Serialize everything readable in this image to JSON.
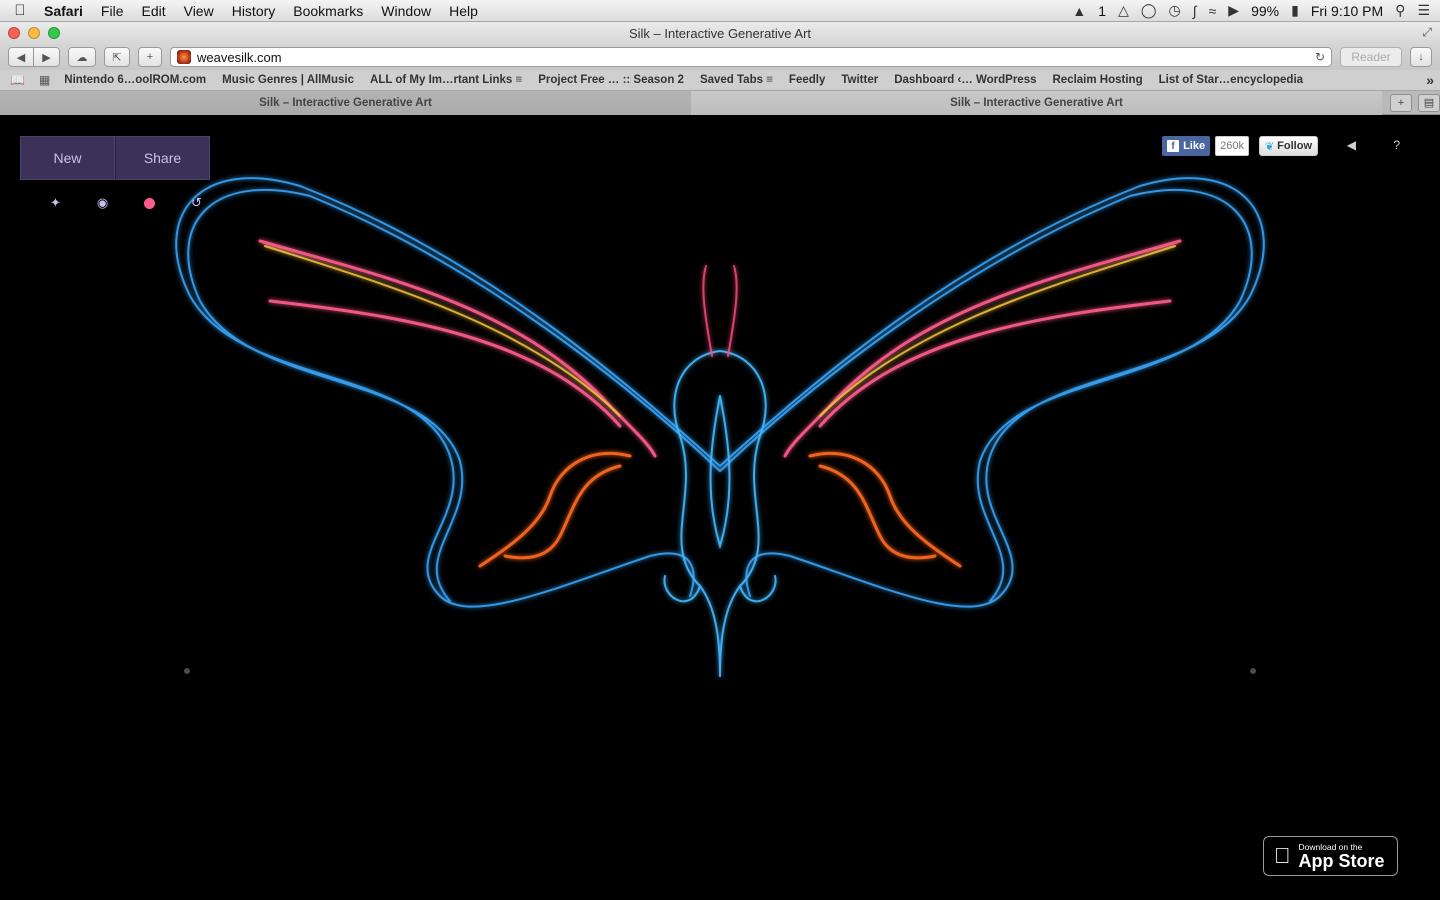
{
  "menubar": {
    "apple": "",
    "app": "Safari",
    "items": [
      "File",
      "Edit",
      "View",
      "History",
      "Bookmarks",
      "Window",
      "Help"
    ],
    "status": {
      "adobe": "1",
      "battery": "99%",
      "clock": "Fri 9:10 PM"
    }
  },
  "window": {
    "title": "Silk – Interactive Generative Art"
  },
  "toolbar": {
    "url": "weavesilk.com",
    "reader": "Reader"
  },
  "bookmarks": [
    "Nintendo 6…oolROM.com",
    "Music Genres | AllMusic",
    "ALL of My Im…rtant Links ≡",
    "Project Free … :: Season 2",
    "Saved Tabs ≡",
    "Feedly",
    "Twitter",
    "Dashboard ‹… WordPress",
    "Reclaim Hosting",
    "List of Star…encyclopedia"
  ],
  "tabs": [
    {
      "label": "Silk – Interactive Generative Art"
    },
    {
      "label": "Silk – Interactive Generative Art"
    }
  ],
  "page": {
    "new_label": "New",
    "share_label": "Share",
    "fb_like": "Like",
    "fb_count": "260k",
    "twitter_follow": "Follow",
    "help": "?",
    "appstore_small": "Download on the",
    "appstore_big": "App Store",
    "brush_color": "#ff5c8d"
  }
}
